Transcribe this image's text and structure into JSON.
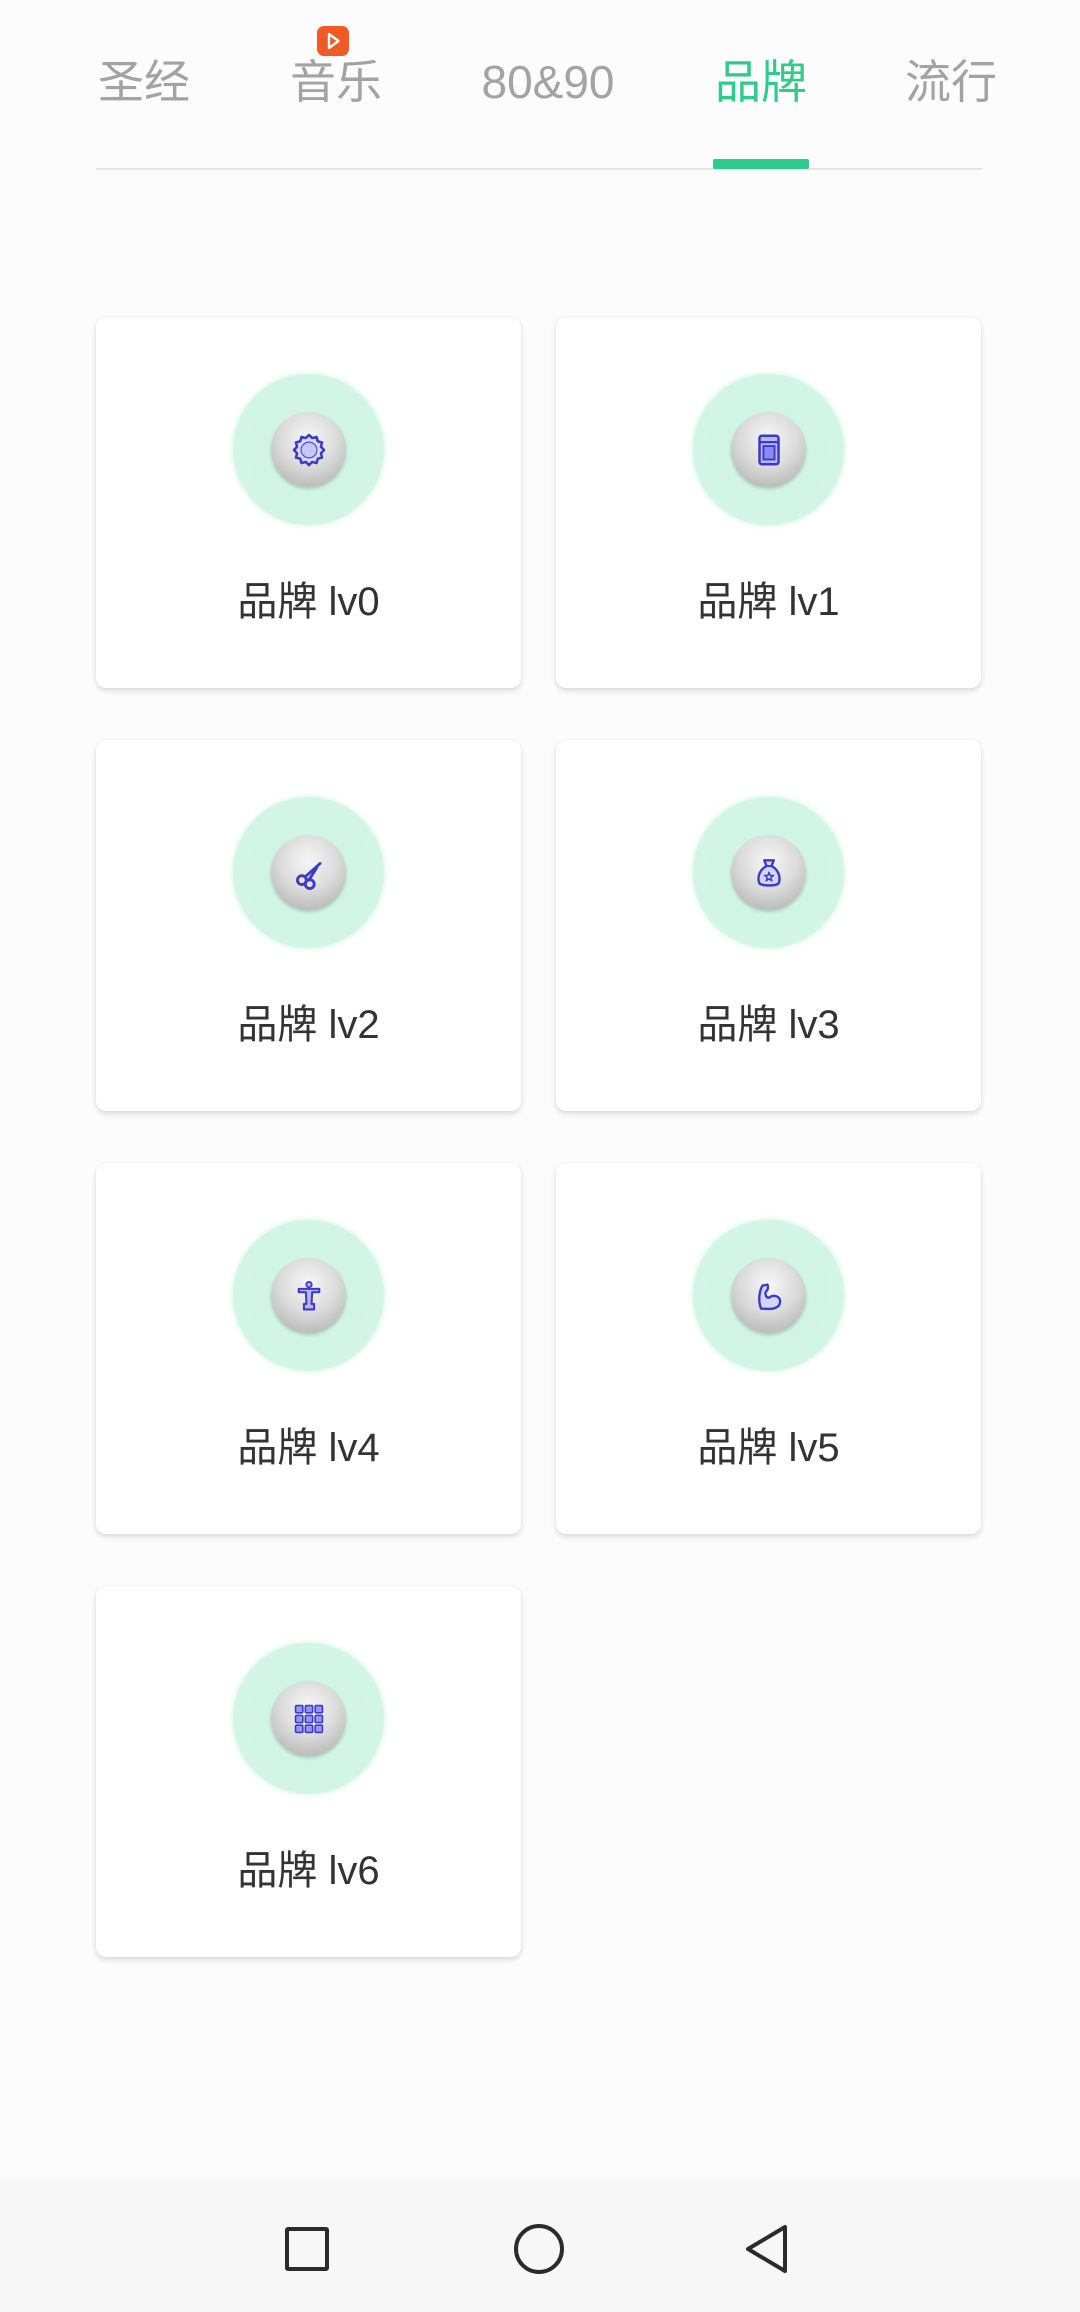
{
  "tabs": {
    "items": [
      {
        "label": "圣经"
      },
      {
        "label": "音乐",
        "badge_icon": "play-badge-icon"
      },
      {
        "label": "80&90"
      },
      {
        "label": "品牌"
      },
      {
        "label": "流行"
      }
    ],
    "active_index": 3
  },
  "levels": {
    "cards": [
      {
        "label": "品牌 lv0",
        "icon": "seal-badge-icon"
      },
      {
        "label": "品牌 lv1",
        "icon": "notebook-icon"
      },
      {
        "label": "品牌 lv2",
        "icon": "scissors-icon"
      },
      {
        "label": "品牌 lv3",
        "icon": "money-bag-icon"
      },
      {
        "label": "品牌 lv4",
        "icon": "statue-icon"
      },
      {
        "label": "品牌 lv5",
        "icon": "flexed-arm-icon"
      },
      {
        "label": "品牌 lv6",
        "icon": "grid-icon"
      }
    ]
  },
  "system_nav": {
    "recent_icon": "square-icon",
    "home_icon": "circle-icon",
    "back_icon": "back-triangle-icon"
  },
  "colors": {
    "accent": "#2fcb8c",
    "tab_inactive": "#a3a3a3",
    "icon_ring": "#d3f5e8",
    "icon_glyph": "#3d3bc4",
    "badge": "#f15a24",
    "label_text": "#333333"
  }
}
